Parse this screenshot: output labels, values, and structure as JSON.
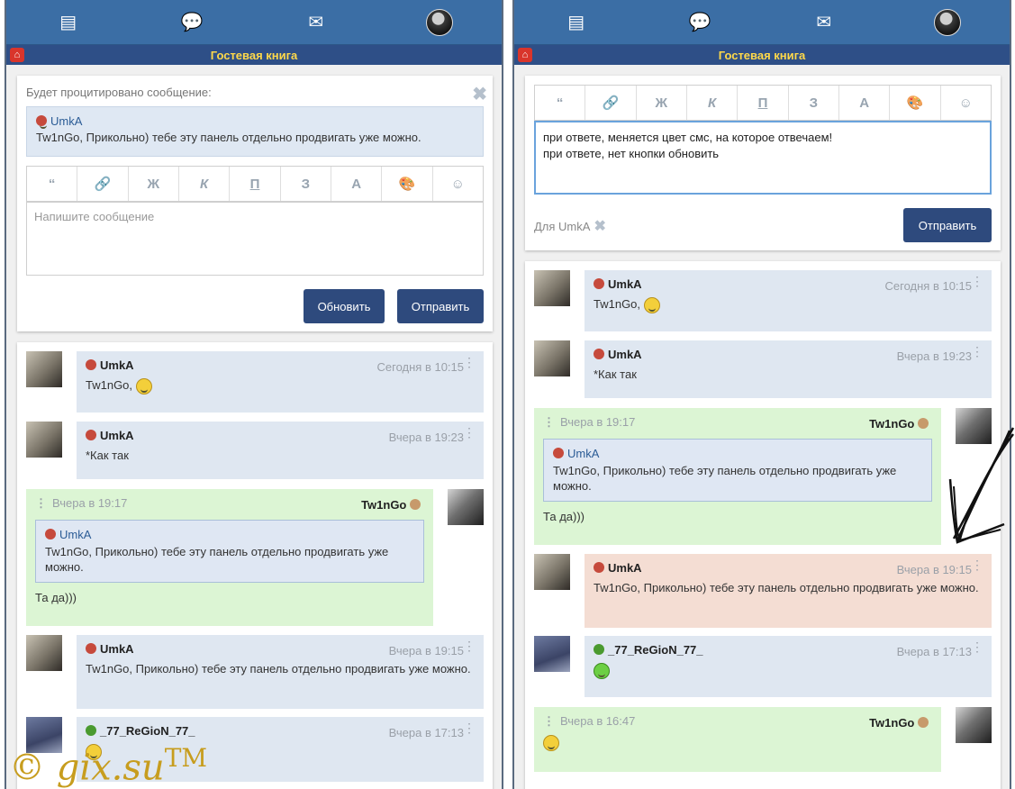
{
  "header": {
    "title": "Гостевая книга",
    "icons": [
      "guestbook-icon",
      "chat-icon",
      "mail-icon",
      "avatar"
    ]
  },
  "left": {
    "quote_heading": "Будет процитировано сообщение:",
    "quote": {
      "name": "UmkA",
      "text": "Tw1nGo, Прикольно) тебе эту панель отдельно продвигать уже можно."
    },
    "toolbar": [
      "“",
      "🔗",
      "Ж",
      "К",
      "П",
      "З",
      "A",
      "🎨",
      "☺"
    ],
    "placeholder": "Напишите сообщение",
    "refresh_label": "Обновить",
    "send_label": "Отправить",
    "messages": [
      {
        "author": "UmkA",
        "time": "Сегодня в 10:15",
        "text": "Tw1nGo,"
      },
      {
        "author": "UmkA",
        "time": "Вчера в 19:23",
        "text": "*Как так"
      },
      {
        "author": "Tw1nGo",
        "time": "Вчера в 19:17",
        "quote_name": "UmkA",
        "quote_text": "Tw1nGo, Прикольно) тебе эту панель отдельно продвигать уже можно.",
        "text": "Та да)))"
      },
      {
        "author": "UmkA",
        "time": "Вчера в 19:15",
        "text": "Tw1nGo, Прикольно) тебе эту панель отдельно продвигать уже можно."
      },
      {
        "author": "_77_ReGioN_77_",
        "time": "Вчера в 17:13",
        "text": ""
      }
    ]
  },
  "right": {
    "editor_text_1": "при ответе, меняется цвет смс, на которое отвечаем!",
    "editor_text_2": "при ответе, нет кнопки обновить",
    "reply_to": "Для UmkA",
    "send_label": "Отправить",
    "messages": [
      {
        "author": "UmkA",
        "time": "Сегодня в 10:15",
        "text": "Tw1nGo,"
      },
      {
        "author": "UmkA",
        "time": "Вчера в 19:23",
        "text": "*Как так"
      },
      {
        "author": "Tw1nGo",
        "time": "Вчера в 19:17",
        "quote_name": "UmkA",
        "quote_text": "Tw1nGo, Прикольно) тебе эту панель отдельно продвигать уже можно.",
        "text": "Та да)))"
      },
      {
        "author": "UmkA",
        "time": "Вчера в 19:15",
        "text": "Tw1nGo, Прикольно) тебе эту панель отдельно продвигать уже можно."
      },
      {
        "author": "_77_ReGioN_77_",
        "time": "Вчера в 17:13",
        "text": ""
      },
      {
        "author": "Tw1nGo",
        "time": "Вчера в 16:47",
        "text": ""
      }
    ]
  },
  "watermark": {
    "text": "© gix.su",
    "tm": "TM"
  },
  "colors": {
    "topbar": "#3b6ea5",
    "titlebar": "#2e4f87",
    "title": "#ffd94a",
    "button": "#2e4a7d",
    "bubble_blue": "#dfe7f1",
    "bubble_green": "#dcf5d4",
    "bubble_pink": "#f4ddd3"
  }
}
